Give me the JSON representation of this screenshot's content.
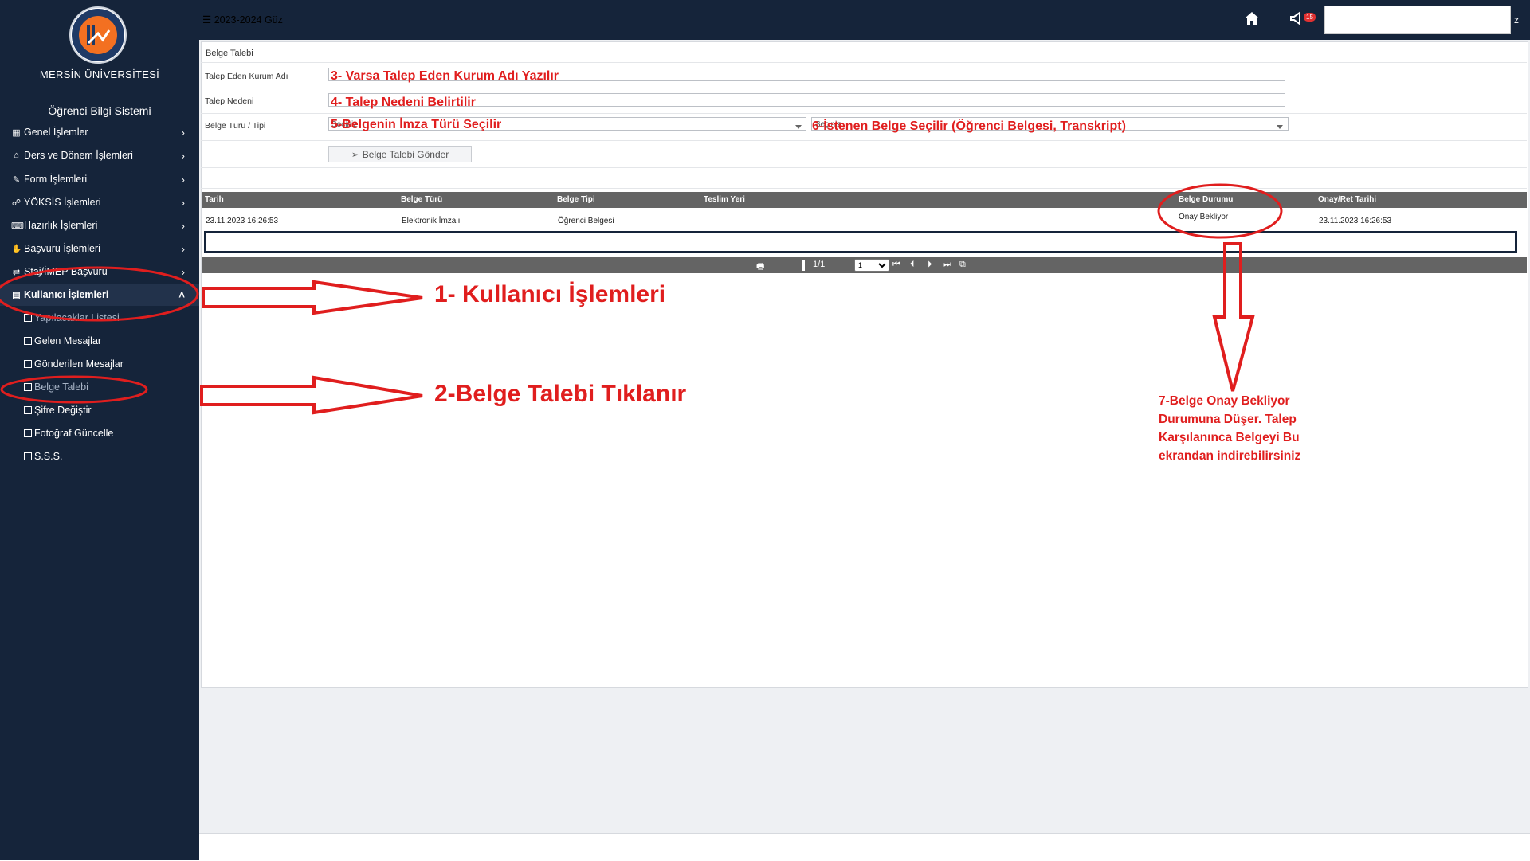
{
  "sidebar": {
    "university": "MERSİN ÜNİVERSİTESİ",
    "system": "Öğrenci Bilgi Sistemi",
    "menu": [
      {
        "label": "Genel İşlemler",
        "icon": "table-icon"
      },
      {
        "label": "Ders ve Dönem İşlemleri",
        "icon": "building-icon"
      },
      {
        "label": "Form İşlemleri",
        "icon": "edit-icon"
      },
      {
        "label": "YÖKSİS İşlemleri",
        "icon": "users-icon"
      },
      {
        "label": "Hazırlık İşlemleri",
        "icon": "keyboard-icon"
      },
      {
        "label": "Başvuru İşlemleri",
        "icon": "handshake-icon"
      },
      {
        "label": "Staj/İMEP Başvuru",
        "icon": "exchange-icon"
      },
      {
        "label": "Kullanıcı İşlemleri",
        "icon": "clipboard-icon"
      }
    ],
    "submenu": [
      "Yapılacaklar Listesi",
      "Gelen Mesajlar",
      "Gönderilen Mesajlar",
      "Belge Talebi",
      "Şifre Değiştir",
      "Fotoğraf Güncelle",
      "S.S.S."
    ]
  },
  "topbar": {
    "term": "2023-2024 Güz",
    "notification_count": "15",
    "tail": "z"
  },
  "form": {
    "title": "Belge Talebi",
    "label_institution": "Talep Eden Kurum Adı",
    "label_reason": "Talep Nedeni",
    "label_type": "Belge Türü / Tipi",
    "select_type_placeholder": "Seçiniz",
    "select_kind_placeholder": "Seçiniz",
    "send_button": "Belge Talebi Gönder"
  },
  "table": {
    "headers": [
      "Tarih",
      "Belge Türü",
      "Belge Tipi",
      "Teslim Yeri",
      "Belge Durumu",
      "Onay/Ret Tarihi"
    ],
    "row": [
      "23.11.2023 16:26:53",
      "Elektronik İmzalı",
      "Öğrenci Belgesi",
      "",
      "Onay Bekliyor",
      "23.11.2023 16:26:53"
    ]
  },
  "pager": {
    "page_info": "1/1",
    "page_select": "1"
  },
  "annotations": {
    "step1": "1- Kullanıcı İşlemleri",
    "step2": "2-Belge Talebi Tıklanır",
    "step3": "3- Varsa Talep Eden Kurum Adı Yazılır",
    "step4": "4- Talep Nedeni Belirtilir",
    "step5": "5-Belgenin İmza Türü Seçilir",
    "step6": "6-İstenen Belge Seçilir (Öğrenci Belgesi, Transkript)",
    "step7": "7-Belge Onay Bekliyor Durumuna Düşer. Talep Karşılanınca Belgeyi Bu ekrandan indirebilirsiniz"
  },
  "colors": {
    "sidebar": "#15243a",
    "annotation_red": "#e01e1e",
    "table_header": "#646464"
  }
}
